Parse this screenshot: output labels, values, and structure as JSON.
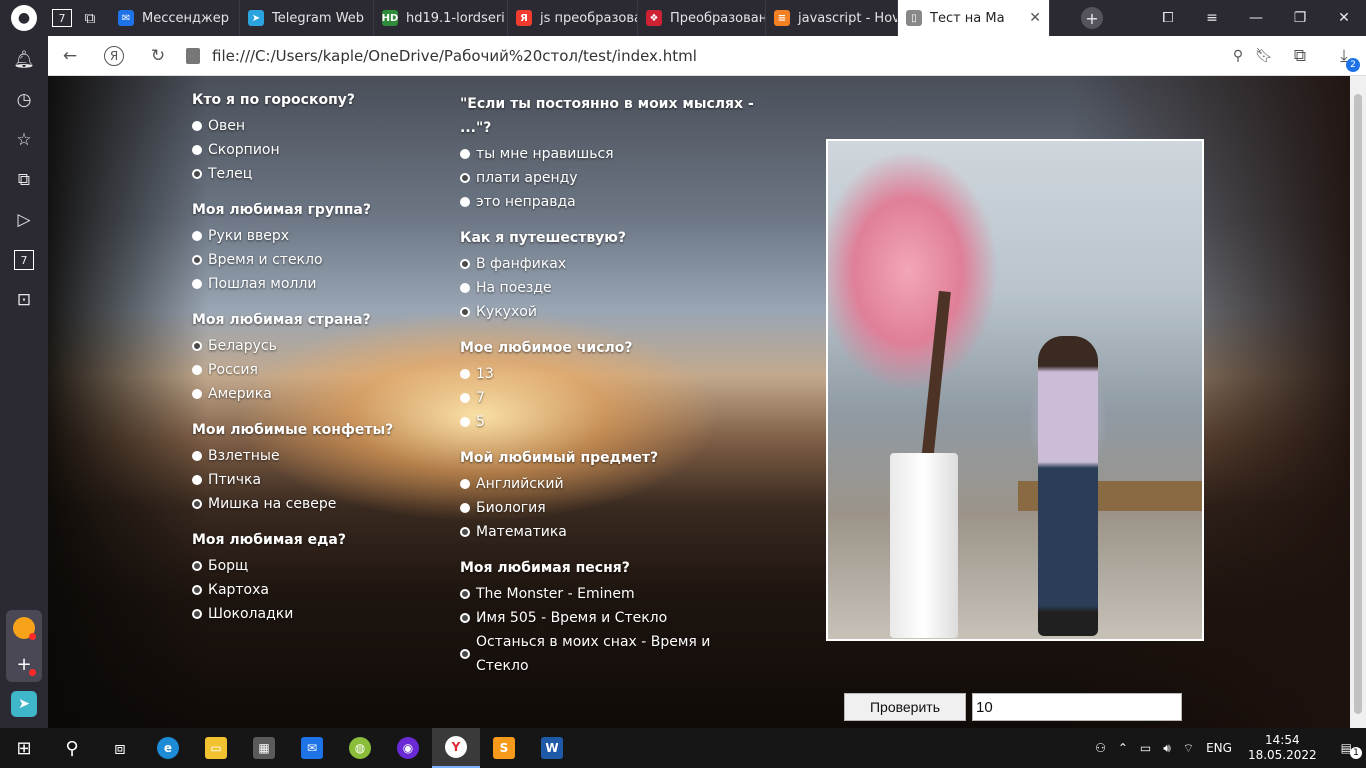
{
  "tabs": [
    {
      "label": "Мессенджер",
      "color": "#1e73e8",
      "glyph": "✉"
    },
    {
      "label": "Telegram Web",
      "color": "#2aa3df",
      "glyph": "➤"
    },
    {
      "label": "hd19.1-lordseri",
      "color": "#2e8b3a",
      "glyph": "HD"
    },
    {
      "label": "js преобразова",
      "color": "#f03c2e",
      "glyph": "Я"
    },
    {
      "label": "Преобразован",
      "color": "#cc2233",
      "glyph": "❖"
    },
    {
      "label": "javascript - Hov",
      "color": "#f48024",
      "glyph": "≡"
    },
    {
      "label": "Тест на Ма",
      "color": "#888888",
      "glyph": "▯"
    }
  ],
  "address": {
    "url": "file:///C:/Users/kaple/OneDrive/Рабочий%20стол/test/index.html"
  },
  "sidebar": {
    "badge": "7",
    "downloads_badge": "2"
  },
  "quiz": {
    "left": [
      {
        "q": "Кто я по гороскопу?",
        "options": [
          {
            "text": "Овен",
            "selected": false
          },
          {
            "text": "Скорпион",
            "selected": false
          },
          {
            "text": "Телец",
            "selected": true
          }
        ]
      },
      {
        "q": "Моя любимая группа?",
        "options": [
          {
            "text": "Руки вверх",
            "selected": false
          },
          {
            "text": "Время и стекло",
            "selected": true
          },
          {
            "text": "Пошлая молли",
            "selected": false
          }
        ]
      },
      {
        "q": "Моя любимая страна?",
        "options": [
          {
            "text": "Беларусь",
            "selected": true
          },
          {
            "text": "Россия",
            "selected": false
          },
          {
            "text": "Америка",
            "selected": false
          }
        ]
      },
      {
        "q": "Мои любимые конфеты?",
        "options": [
          {
            "text": "Взлетные",
            "selected": false
          },
          {
            "text": "Птичка",
            "selected": false
          },
          {
            "text": "Мишка на севере",
            "selected": true
          }
        ]
      },
      {
        "q": "Моя любимая еда?",
        "options": [
          {
            "text": "Борщ",
            "selected": true
          },
          {
            "text": "Картоха",
            "selected": true
          },
          {
            "text": "Шоколадки",
            "selected": true
          }
        ]
      }
    ],
    "right": [
      {
        "q": "\"Если ты постоянно в моих мыслях - ...\"?",
        "options": [
          {
            "text": "ты мне нравишься",
            "selected": false
          },
          {
            "text": "плати аренду",
            "selected": true
          },
          {
            "text": "это неправда",
            "selected": false
          }
        ]
      },
      {
        "q": "Как я путешествую?",
        "options": [
          {
            "text": "В фанфиках",
            "selected": true
          },
          {
            "text": "На поезде",
            "selected": false
          },
          {
            "text": "Кукухой",
            "selected": true
          }
        ]
      },
      {
        "q": "Мое любимое число?",
        "options": [
          {
            "text": "13",
            "selected": false
          },
          {
            "text": "7",
            "selected": false
          },
          {
            "text": "5",
            "selected": false
          }
        ]
      },
      {
        "q": "Мой любимый предмет?",
        "options": [
          {
            "text": "Английский",
            "selected": false
          },
          {
            "text": "Биология",
            "selected": false
          },
          {
            "text": "Математика",
            "selected": true
          }
        ]
      },
      {
        "q": "Моя любимая песня?",
        "options": [
          {
            "text": "The Monster - Eminem",
            "selected": true
          },
          {
            "text": "Имя 505 - Время и Стекло",
            "selected": true
          },
          {
            "text": "Останься в моих снах - Время и Стекло",
            "selected": true
          }
        ]
      }
    ]
  },
  "controls": {
    "check_label": "Проверить",
    "score_value": "10"
  },
  "taskbar": {
    "lang": "ENG",
    "time": "14:54",
    "date": "18.05.2022",
    "notif_count": "1"
  }
}
